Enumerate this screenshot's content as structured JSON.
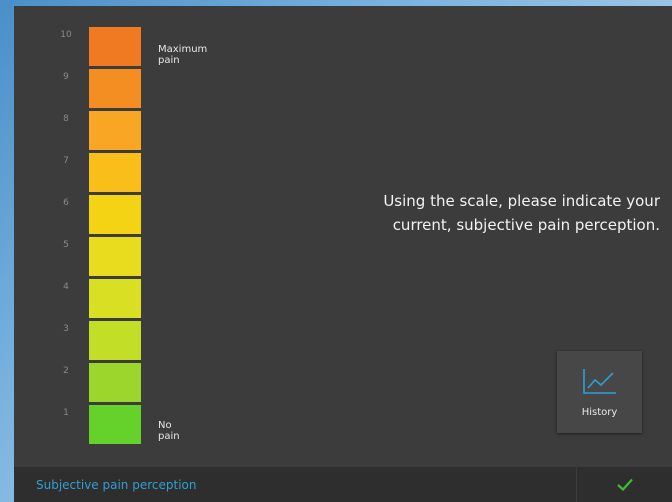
{
  "scale": {
    "levels": [
      {
        "value": "10",
        "color": "#f07a22"
      },
      {
        "value": "9",
        "color": "#f48d22"
      },
      {
        "value": "8",
        "color": "#f8a623"
      },
      {
        "value": "7",
        "color": "#f9be1a"
      },
      {
        "value": "6",
        "color": "#f4d314"
      },
      {
        "value": "5",
        "color": "#e9dc1e"
      },
      {
        "value": "4",
        "color": "#d9df22"
      },
      {
        "value": "3",
        "color": "#c2de26"
      },
      {
        "value": "2",
        "color": "#9cd62c"
      },
      {
        "value": "1",
        "color": "#64d22a"
      }
    ],
    "max_label": "Maximum pain",
    "min_label": "No pain"
  },
  "instruction": {
    "line1": "Using the scale, please indicate your",
    "line2": "current, subjective pain perception."
  },
  "history_button": {
    "label": "History",
    "icon": "chart-line-icon"
  },
  "footer": {
    "title": "Subjective pain perception",
    "confirm_icon": "checkmark-icon",
    "accent_color": "#2f9fd3",
    "check_color": "#39c12f"
  }
}
